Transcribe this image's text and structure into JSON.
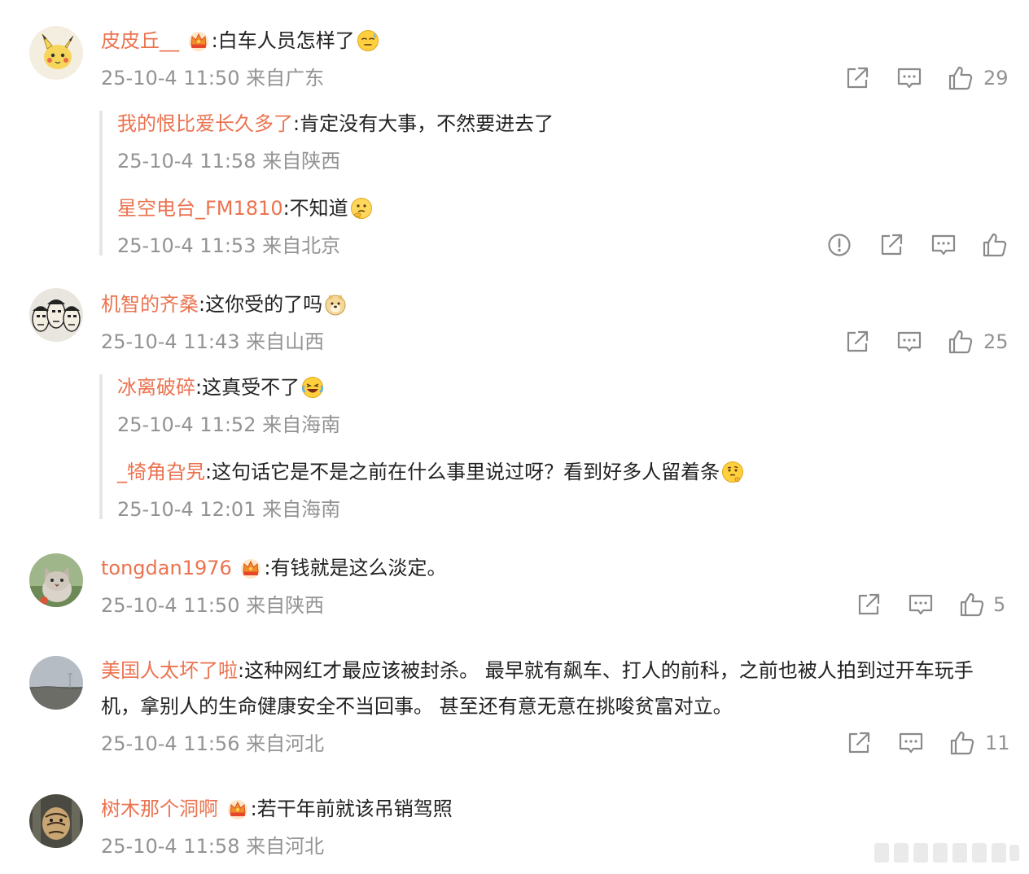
{
  "comments": [
    {
      "user": "皮皮丘__",
      "text": ":白车人员怎样了",
      "time": "25-10-4 11:50",
      "location": "来自广东",
      "likes": "29",
      "replies": [
        {
          "user": "我的恨比爱长久多了",
          "text": ":肯定没有大事，不然要进去了",
          "time": "25-10-4 11:58",
          "location": "来自陕西"
        },
        {
          "user": "星空电台_FM1810",
          "text": ":不知道",
          "time": "25-10-4 11:53",
          "location": "来自北京"
        }
      ]
    },
    {
      "user": "机智的齐桑",
      "text": ":这你受的了吗",
      "time": "25-10-4 11:43",
      "location": "来自山西",
      "likes": "25",
      "replies": [
        {
          "user": "冰离破碎",
          "text": ":这真受不了",
          "time": "25-10-4 11:52",
          "location": "来自海南"
        },
        {
          "user": "_犄角旮旯",
          "text": ":这句话它是不是之前在什么事里说过呀？看到好多人留着条",
          "time": "25-10-4 12:01",
          "location": "来自海南"
        }
      ]
    },
    {
      "user": "tongdan1976",
      "text": ":有钱就是这么淡定。",
      "time": "25-10-4 11:50",
      "location": "来自陕西",
      "likes": "5"
    },
    {
      "user": "美国人太坏了啦",
      "text": ":这种网红才最应该被封杀。 最早就有飙车、打人的前科，之前也被人拍到过开车玩手机，拿别人的生命健康安全不当回事。 甚至还有意无意在挑唆贫富对立。",
      "time": "25-10-4 11:56",
      "location": "来自河北",
      "likes": "11"
    },
    {
      "user": "树木那个洞啊",
      "text": ":若干年前就该吊销驾照",
      "time": "25-10-4 11:58",
      "location": "来自河北"
    }
  ],
  "icons": {
    "share": "share-icon",
    "comment": "comment-icon",
    "like": "thumbs-up-icon",
    "report": "report-icon",
    "vip": "crown-badge-icon"
  },
  "colors": {
    "username": "#eb7350",
    "meta": "#939393",
    "text": "#222222",
    "thread_line": "#e6e6e6"
  }
}
